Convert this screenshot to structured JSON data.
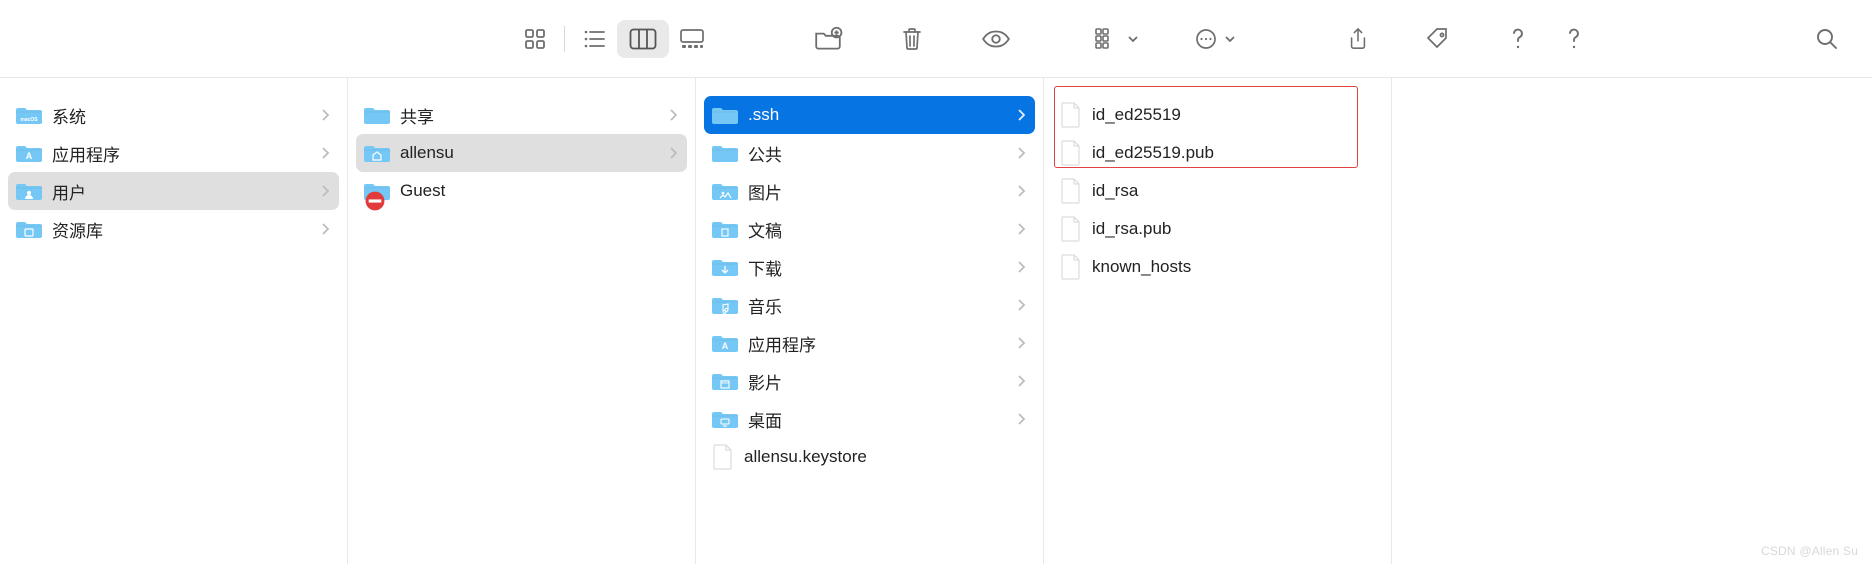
{
  "columns": [
    {
      "items": [
        {
          "label": "系统",
          "kind": "folder-os",
          "hasChevron": true,
          "sel": ""
        },
        {
          "label": "应用程序",
          "kind": "folder-apps",
          "hasChevron": true,
          "sel": ""
        },
        {
          "label": "用户",
          "kind": "folder-users",
          "hasChevron": true,
          "sel": "grey"
        },
        {
          "label": "资源库",
          "kind": "folder-library",
          "hasChevron": true,
          "sel": ""
        }
      ]
    },
    {
      "items": [
        {
          "label": "共享",
          "kind": "folder",
          "hasChevron": true,
          "sel": ""
        },
        {
          "label": "allensu",
          "kind": "folder-home",
          "hasChevron": true,
          "sel": "grey"
        },
        {
          "label": "Guest",
          "kind": "folder-nosym",
          "hasChevron": false,
          "sel": ""
        }
      ]
    },
    {
      "items": [
        {
          "label": ".ssh",
          "kind": "folder",
          "hasChevron": true,
          "sel": "blue"
        },
        {
          "label": "公共",
          "kind": "folder",
          "hasChevron": true,
          "sel": ""
        },
        {
          "label": "图片",
          "kind": "folder-pictures",
          "hasChevron": true,
          "sel": ""
        },
        {
          "label": "文稿",
          "kind": "folder-documents",
          "hasChevron": true,
          "sel": ""
        },
        {
          "label": "下载",
          "kind": "folder-downloads",
          "hasChevron": true,
          "sel": ""
        },
        {
          "label": "音乐",
          "kind": "folder-music",
          "hasChevron": true,
          "sel": ""
        },
        {
          "label": "应用程序",
          "kind": "folder-apps",
          "hasChevron": true,
          "sel": ""
        },
        {
          "label": "影片",
          "kind": "folder-movies",
          "hasChevron": true,
          "sel": ""
        },
        {
          "label": "桌面",
          "kind": "folder-desktop",
          "hasChevron": true,
          "sel": ""
        },
        {
          "label": "allensu.keystore",
          "kind": "file",
          "hasChevron": false,
          "sel": ""
        }
      ]
    },
    {
      "items": [
        {
          "label": "id_ed25519",
          "kind": "file",
          "hasChevron": false,
          "sel": ""
        },
        {
          "label": "id_ed25519.pub",
          "kind": "file",
          "hasChevron": false,
          "sel": ""
        },
        {
          "label": "id_rsa",
          "kind": "file",
          "hasChevron": false,
          "sel": ""
        },
        {
          "label": "id_rsa.pub",
          "kind": "file",
          "hasChevron": false,
          "sel": ""
        },
        {
          "label": "known_hosts",
          "kind": "file",
          "hasChevron": false,
          "sel": ""
        }
      ]
    }
  ],
  "watermark": "CSDN @Allen Su"
}
